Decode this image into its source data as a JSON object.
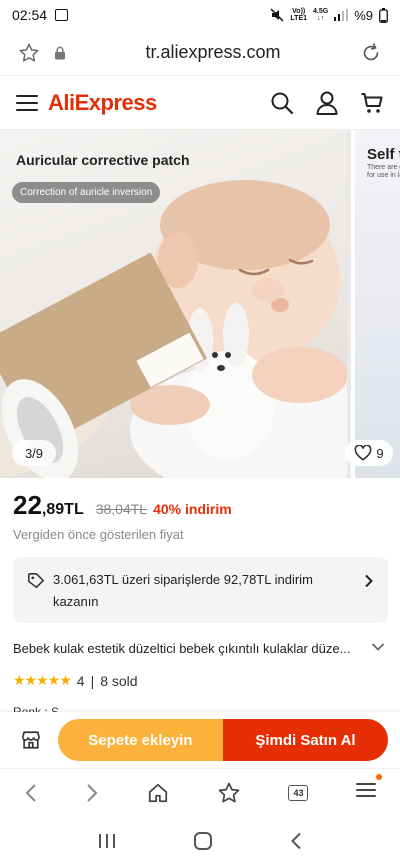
{
  "status_bar": {
    "time": "02:54",
    "volte_top": "Vo))",
    "volte_bottom": "LTE1",
    "network_top": "4.5G",
    "network_bottom": "↓↑",
    "battery": "%9"
  },
  "browser": {
    "url": "tr.aliexpress.com",
    "tab_count": "43"
  },
  "app": {
    "logo": "AliExpress"
  },
  "gallery": {
    "slide_title": "Auricular corrective patch",
    "slide_pill": "Correction of auricle inversion",
    "next_title": "Self t",
    "next_sub_1": "There are g",
    "next_sub_2": "for use in la",
    "counter": "3/9",
    "likes": "9"
  },
  "product": {
    "price_int": "22",
    "price_dec": ",89TL",
    "old_price": "38,04TL",
    "discount": "40% indirim",
    "tax_note": "Vergiden önce gösterilen fiyat",
    "coupon_text": "3.061,63TL üzeri siparişlerde 92,78TL indirim kazanın",
    "title": "Bebek kulak estetik düzeltici bebek çıkıntılı kulaklar düze...",
    "stars": "★★★★★",
    "rating": "4",
    "sold": "8 sold",
    "color_label": "Renk : S"
  },
  "actions": {
    "add_to_cart": "Sepete ekleyin",
    "buy_now": "Şimdi Satın Al"
  },
  "colors": {
    "brand": "#e62e04",
    "cart": "#fcb23a",
    "star": "#f6b100"
  }
}
